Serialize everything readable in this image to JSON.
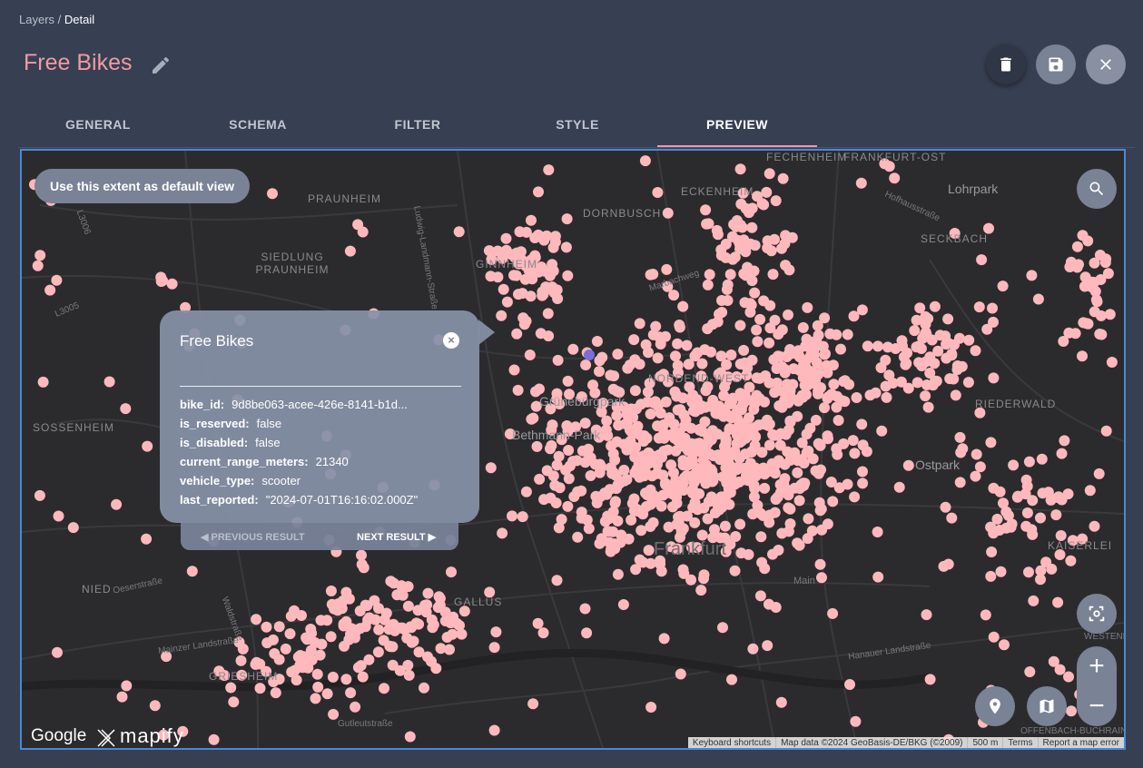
{
  "breadcrumb": {
    "parent": "Layers",
    "separator": " / ",
    "current": "Detail"
  },
  "page": {
    "title": "Free Bikes"
  },
  "colors": {
    "accent": "#f09aa3",
    "point": "#ffb8bc",
    "map_bg": "#2b2b2d",
    "frame": "#4a88d8"
  },
  "icons": {
    "edit": "pencil-icon",
    "delete": "trash-icon",
    "save": "floppy-disk-icon",
    "close": "close-icon",
    "search": "search-icon",
    "geolocate": "crosshair-icon",
    "location": "map-pin-icon",
    "basemap": "map-icon"
  },
  "tabs": [
    {
      "label": "GENERAL",
      "active": false
    },
    {
      "label": "SCHEMA",
      "active": false
    },
    {
      "label": "FILTER",
      "active": false
    },
    {
      "label": "STYLE",
      "active": false
    },
    {
      "label": "PREVIEW",
      "active": true
    }
  ],
  "map": {
    "extent_button": "Use this extent as default view",
    "zoom_in": "+",
    "zoom_out": "−",
    "labels": [
      "FRANKFURT-OST",
      "Lohrpark",
      "PRAUNHEIM",
      "SIEDLUNG PRAUNHEIM",
      "DORNBUSCH",
      "ECKENHEIM",
      "FECHENHEIM",
      "SECKBACH",
      "GINNHEIM",
      "NORDEND-WEST",
      "Grünebürgpark",
      "Bethmann-Park",
      "SOSSENHEIM",
      "RIEDERWALD",
      "Ostpark",
      "Frankfurt",
      "KAISERLEI",
      "NIED",
      "GALLUS",
      "GRIESHEIM",
      "Main",
      "OFFENBACH-BUCHRAIN",
      "WESTEND"
    ],
    "streets": [
      "Ludwig-Landmann-Straße",
      "Marbachweg",
      "Hofhausstraße",
      "Mainzer Landstraße",
      "Gutleutstraße",
      "Oeserstraße",
      "Waldstraße",
      "Hanauer Landstraße",
      "L3005",
      "L3006"
    ],
    "logos": {
      "google": "Google",
      "mapify": "mapify"
    },
    "attribution": [
      "Keyboard shortcuts",
      "Map data ©2024 GeoBasis-DE/BKG (©2009)",
      "500 m",
      "Terms",
      "Report a map error"
    ]
  },
  "popup": {
    "title": "Free Bikes",
    "close": "×",
    "properties": [
      {
        "key": "bike_id:",
        "value": "9d8be063-acee-426e-8141-b1d..."
      },
      {
        "key": "is_reserved:",
        "value": "false"
      },
      {
        "key": "is_disabled:",
        "value": "false"
      },
      {
        "key": "current_range_meters:",
        "value": "21340"
      },
      {
        "key": "vehicle_type:",
        "value": "scooter"
      },
      {
        "key": "last_reported:",
        "value": "\"2024-07-01T16:16:02.000Z\""
      }
    ],
    "prev_label": "PREVIOUS RESULT",
    "next_label": "NEXT RESULT"
  }
}
